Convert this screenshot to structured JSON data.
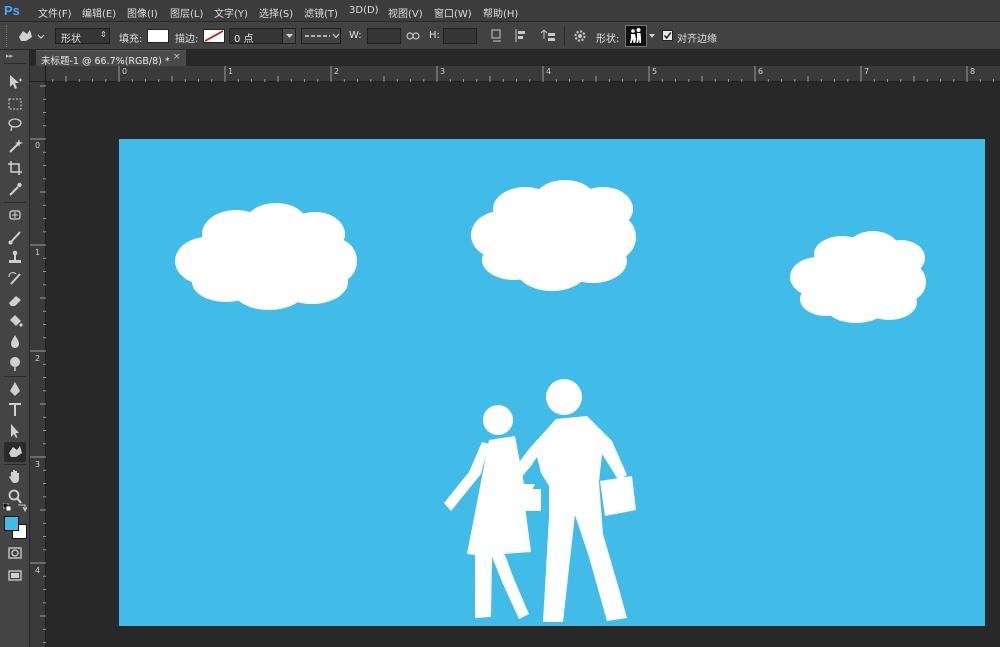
{
  "app": {
    "logo": "Ps"
  },
  "menu": [
    "文件(F)",
    "编辑(E)",
    "图像(I)",
    "图层(L)",
    "文字(Y)",
    "选择(S)",
    "滤镜(T)",
    "3D(D)",
    "视图(V)",
    "窗口(W)",
    "帮助(H)"
  ],
  "options": {
    "mode_value": "形状",
    "fill_label": "填充:",
    "stroke_label": "描边:",
    "stroke_size": "0 点",
    "w_label": "W:",
    "h_label": "H:",
    "shape_label": "形状:",
    "align_edges_label": "对齐边缘",
    "align_edges_checked": true
  },
  "document": {
    "tab_title": "未标题-1 @ 66.7%(RGB/8) *",
    "close": "×"
  },
  "ruler_top": [
    "0",
    "1",
    "2",
    "3",
    "4",
    "5",
    "6",
    "7",
    "8"
  ],
  "ruler_left": [
    "0",
    "1",
    "2",
    "3",
    "4"
  ],
  "colors": {
    "canvas_bg": "#41bce8",
    "foreground": "#41bce8",
    "background": "#ffffff",
    "shapes": "#ffffff"
  },
  "tools": [
    "move-tool-icon",
    "marquee-tool-icon",
    "lasso-tool-icon",
    "magic-wand-tool-icon",
    "crop-tool-icon",
    "eyedropper-tool-icon",
    "healing-brush-tool-icon",
    "brush-tool-icon",
    "clone-stamp-tool-icon",
    "history-brush-tool-icon",
    "eraser-tool-icon",
    "paint-bucket-tool-icon",
    "blur-tool-icon",
    "dodge-tool-icon",
    "pen-tool-icon",
    "type-tool-icon",
    "path-selection-tool-icon",
    "custom-shape-tool-icon",
    "hand-tool-icon",
    "zoom-tool-icon"
  ]
}
